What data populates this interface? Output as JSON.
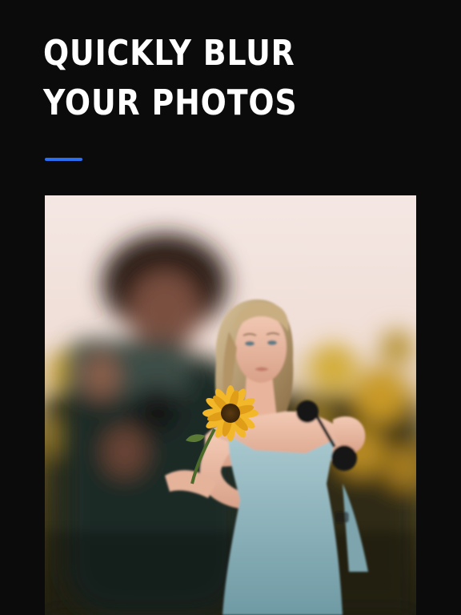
{
  "screen": {
    "headline": "QUICKLY BLUR YOUR PHOTOS",
    "accent_color": "#2a6ef2",
    "background_color": "#0b0b0c"
  },
  "photo": {
    "subject": "sharp-portrait-woman-with-sunflower",
    "background": "blurred-person-with-camera-and-sunflower-field"
  }
}
